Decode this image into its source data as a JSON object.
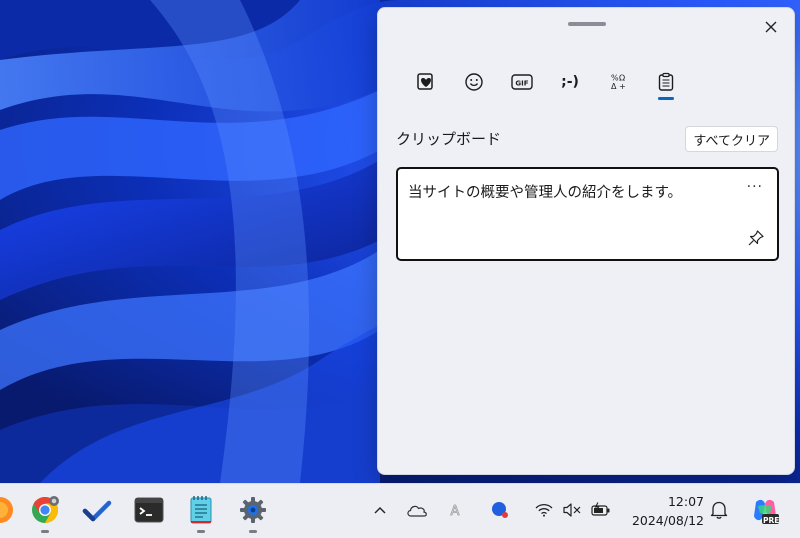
{
  "panel": {
    "tabs": [
      {
        "name": "favorites",
        "icon": "heart-note-icon"
      },
      {
        "name": "emoji",
        "icon": "smiley-icon"
      },
      {
        "name": "gif",
        "icon": "gif-icon",
        "label": "GIF"
      },
      {
        "name": "kaomoji",
        "label": ";-)"
      },
      {
        "name": "symbols",
        "icon": "symbols-icon"
      },
      {
        "name": "clipboard",
        "icon": "clipboard-icon",
        "active": true
      }
    ],
    "clipboard_title": "クリップボード",
    "clear_all_label": "すべてクリア",
    "items": [
      {
        "text": "当サイトの概要や管理人の紹介をします。",
        "more_label": "···"
      }
    ]
  },
  "taskbar": {
    "apps": [
      "firefox",
      "chrome",
      "todo",
      "terminal",
      "notepad",
      "settings"
    ],
    "tray": [
      "chevron-up-icon",
      "onedrive-cloud-icon",
      "ime-icon",
      "app-icon",
      "wifi-icon",
      "volume-muted-icon",
      "battery-icon"
    ],
    "time": "12:07",
    "date": "2024/08/12",
    "copilot_badge": "PRE"
  },
  "colors": {
    "accent": "#0a66c2",
    "panel_bg": "#eef0f6",
    "taskbar_bg": "#eceef3"
  }
}
